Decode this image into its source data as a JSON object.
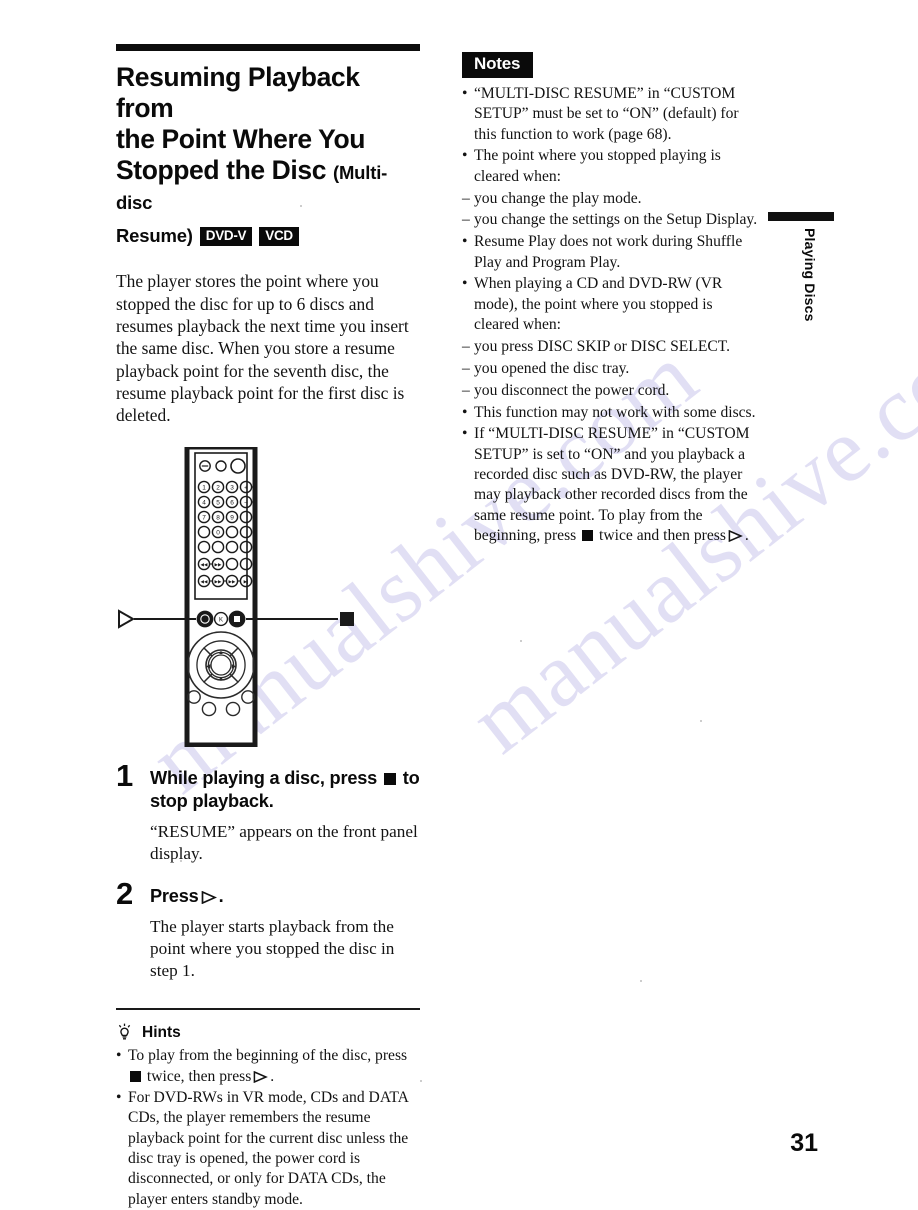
{
  "page": {
    "number": "31",
    "side_tab_label": "Playing Discs",
    "watermark": "manualshive.com"
  },
  "heading": {
    "line1": "Resuming Playback from",
    "line2": "the Point Where You",
    "line3_main": "Stopped the Disc",
    "line3_small": "(Multi-disc",
    "line4_small": "Resume)",
    "badges": [
      "DVD-V",
      "VCD"
    ]
  },
  "intro": "The player stores the point where you stopped the disc for up to 6 discs and resumes playback the next time you insert the same disc. When you store a resume playback point for the seventh disc, the resume playback point for the first disc is deleted.",
  "remote": {
    "caption_left_icon": "play-icon",
    "caption_right_icon": "stop-icon",
    "keypad_digits": [
      "1",
      "2",
      "3",
      "4",
      "5",
      "6",
      "7",
      "8",
      "9",
      "0"
    ],
    "volume_plus": "+",
    "volume_minus": "−",
    "center_button_label": "K"
  },
  "steps": [
    {
      "number": "1",
      "head_before": "While playing a disc, press",
      "head_icon": "stop-icon",
      "head_after": "to stop playback.",
      "body": "“RESUME” appears on the front panel display."
    },
    {
      "number": "2",
      "head_before": "Press",
      "head_icon": "play-icon",
      "head_after": ".",
      "body": "The player starts playback from the point where you stopped the disc in step 1."
    }
  ],
  "hints": {
    "icon": "lightbulb-icon",
    "title": "Hints",
    "items": [
      {
        "marker": "•",
        "text_before": "To play from the beginning of the disc, press",
        "icon_a": "stop-icon",
        "text_middle": "twice, then press",
        "icon_b": "play-icon",
        "text_after": "."
      },
      {
        "marker": "•",
        "text": "For DVD-RWs in VR mode, CDs and DATA CDs, the player remembers the resume playback point for the current disc unless the disc tray is opened, the power cord is disconnected, or only for DATA CDs, the player enters standby mode."
      }
    ]
  },
  "notes": {
    "title": "Notes",
    "items": [
      {
        "marker": "•",
        "text": "“MULTI-DISC RESUME” in “CUSTOM SETUP” must be set to “ON” (default) for this function to work (page 68)."
      },
      {
        "marker": "•",
        "text": "The point where you stopped playing is cleared when:"
      },
      {
        "marker": "–",
        "text": "you change the play mode."
      },
      {
        "marker": "–",
        "text": "you change the settings on the Setup Display."
      },
      {
        "marker": "•",
        "text": "Resume Play does not work during Shuffle Play and Program Play."
      },
      {
        "marker": "•",
        "text": "When playing a CD and DVD-RW (VR mode), the point where you stopped is cleared when:"
      },
      {
        "marker": "–",
        "text": "you press DISC SKIP or DISC SELECT."
      },
      {
        "marker": "–",
        "text": "you opened the disc tray."
      },
      {
        "marker": "–",
        "text": "you disconnect the power cord."
      },
      {
        "marker": "•",
        "text": "This function may not work with some discs."
      }
    ],
    "last_item": {
      "marker": "•",
      "text_before": "If “MULTI-DISC RESUME” in “CUSTOM SETUP” is set to “ON” and you playback a recorded disc such as DVD-RW, the player may playback other recorded discs from the same resume point. To play from the beginning, press",
      "icon_a": "stop-icon",
      "text_middle": "twice and then press",
      "icon_b": "play-icon",
      "text_after": "."
    }
  },
  "colors": {
    "ink": "#0a0a0a",
    "paper": "#ffffff",
    "watermark": "#c9c6ec"
  }
}
